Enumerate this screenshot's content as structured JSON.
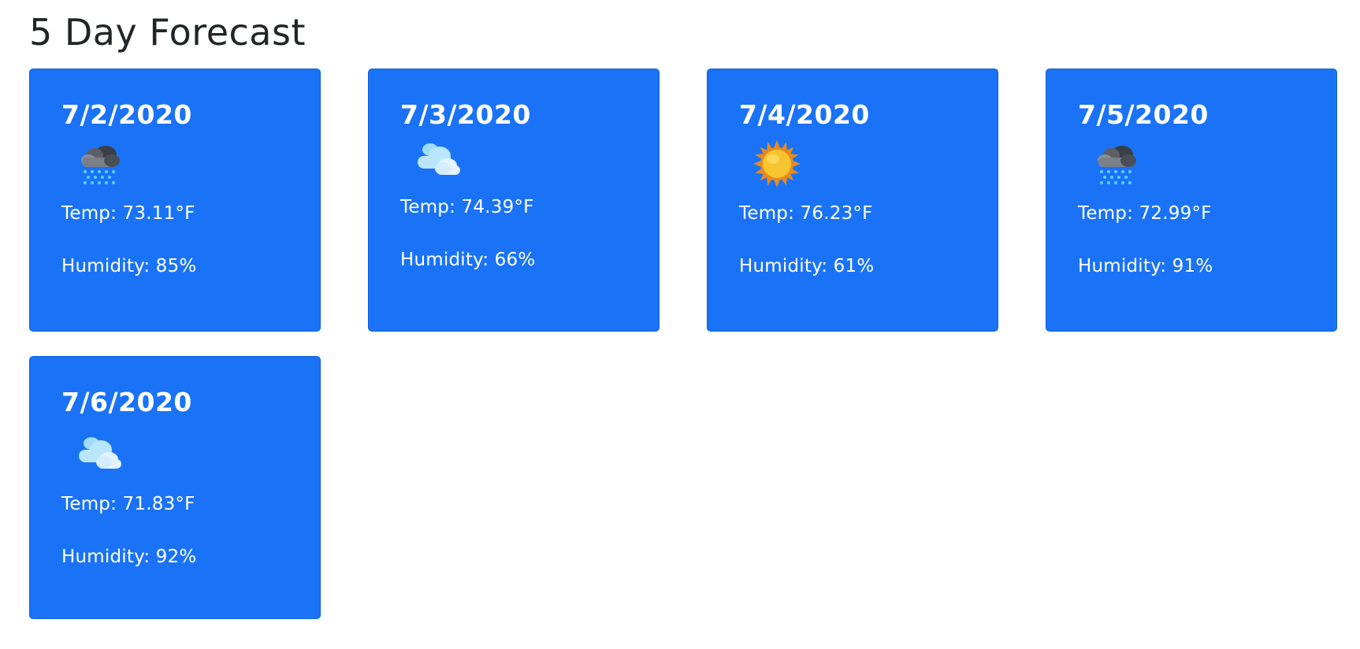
{
  "section": {
    "title": "5 Day Forecast"
  },
  "days": [
    {
      "date": "7/2/2020",
      "icon": "rain-icon",
      "temp": "Temp: 73.11°F",
      "humidity": "Humidity: 85%"
    },
    {
      "date": "7/3/2020",
      "icon": "cloud-icon",
      "temp": "Temp: 74.39°F",
      "humidity": "Humidity: 66%"
    },
    {
      "date": "7/4/2020",
      "icon": "sun-icon",
      "temp": "Temp: 76.23°F",
      "humidity": "Humidity: 61%"
    },
    {
      "date": "7/5/2020",
      "icon": "rain-icon",
      "temp": "Temp: 72.99°F",
      "humidity": "Humidity: 91%"
    },
    {
      "date": "7/6/2020",
      "icon": "cloud-icon",
      "temp": "Temp: 71.83°F",
      "humidity": "Humidity: 92%"
    }
  ],
  "colors": {
    "card_background": "#1a73f7",
    "card_text": "#ffffff",
    "title_text": "#212529"
  }
}
